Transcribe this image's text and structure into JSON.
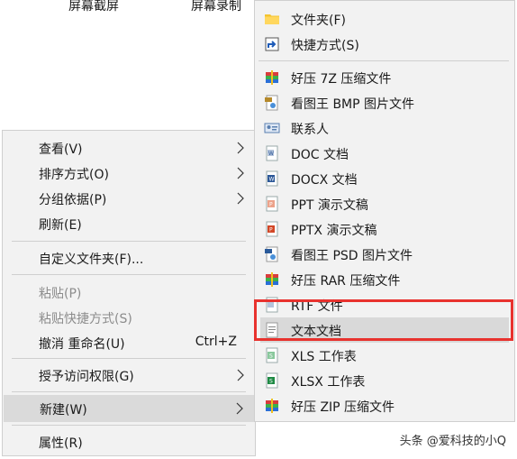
{
  "top_labels": [
    "屏幕截屏",
    "屏幕录制"
  ],
  "context_menu": {
    "items": [
      {
        "label": "查看(V)",
        "has_submenu": true
      },
      {
        "label": "排序方式(O)",
        "has_submenu": true
      },
      {
        "label": "分组依据(P)",
        "has_submenu": true
      },
      {
        "label": "刷新(E)"
      },
      {
        "label": "自定义文件夹(F)..."
      },
      {
        "label": "粘贴(P)",
        "disabled": true
      },
      {
        "label": "粘贴快捷方式(S)",
        "disabled": true
      },
      {
        "label": "撤消 重命名(U)",
        "shortcut": "Ctrl+Z"
      },
      {
        "label": "授予访问权限(G)",
        "has_submenu": true
      },
      {
        "label": "新建(W)",
        "has_submenu": true,
        "highlighted": true
      },
      {
        "label": "属性(R)"
      }
    ]
  },
  "new_submenu": {
    "items": [
      {
        "label": "文件夹(F)",
        "icon": "folder-icon"
      },
      {
        "label": "快捷方式(S)",
        "icon": "shortcut-icon"
      },
      {
        "label": "好压 7Z 压缩文件",
        "icon": "haozip-archive-icon"
      },
      {
        "label": "看图王 BMP 图片文件",
        "icon": "bmp-image-icon"
      },
      {
        "label": "联系人",
        "icon": "contact-icon"
      },
      {
        "label": "DOC 文档",
        "icon": "doc-icon"
      },
      {
        "label": "DOCX 文档",
        "icon": "docx-icon"
      },
      {
        "label": "PPT 演示文稿",
        "icon": "ppt-icon"
      },
      {
        "label": "PPTX 演示文稿",
        "icon": "pptx-icon"
      },
      {
        "label": "看图王 PSD 图片文件",
        "icon": "psd-image-icon"
      },
      {
        "label": "好压 RAR 压缩文件",
        "icon": "haozip-archive-icon"
      },
      {
        "label": "RTF 文件",
        "icon": "rtf-icon"
      },
      {
        "label": "文本文档",
        "icon": "text-document-icon",
        "highlighted": true
      },
      {
        "label": "XLS 工作表",
        "icon": "xls-icon"
      },
      {
        "label": "XLSX 工作表",
        "icon": "xlsx-icon"
      },
      {
        "label": "好压 ZIP 压缩文件",
        "icon": "haozip-archive-icon"
      }
    ]
  },
  "watermark": "头条 @爱科技的小Q",
  "colors": {
    "accent_red": "#e8322e",
    "menu_bg": "#f2f2f2",
    "highlight": "#dadada"
  }
}
